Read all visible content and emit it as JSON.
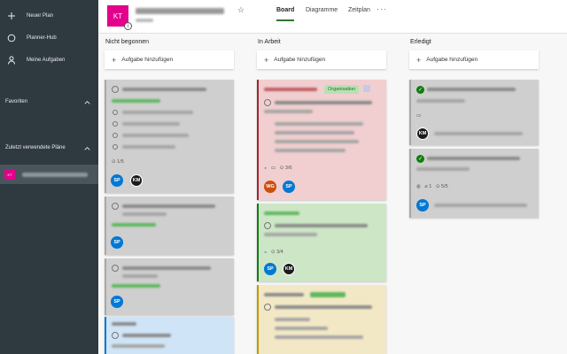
{
  "sidebar": {
    "items": [
      {
        "label": "Neuer Plan",
        "icon": "plus-icon"
      },
      {
        "label": "Planner-Hub",
        "icon": "hub-icon"
      },
      {
        "label": "Meine Aufgaben",
        "icon": "person-icon"
      }
    ],
    "favorites_label": "Favoriten",
    "recent_label": "Zuletzt verwendete Pläne",
    "recent_plan_initials": "KT"
  },
  "header": {
    "plan_initials": "KT",
    "info_glyph": "i",
    "star_glyph": "☆",
    "tabs": [
      {
        "label": "Board",
        "active": true
      },
      {
        "label": "Diagramme",
        "active": false
      },
      {
        "label": "Zeitplan",
        "active": false
      }
    ],
    "more_glyph": "···"
  },
  "board": {
    "add_task_label": "Aufgabe hinzufügen",
    "columns": [
      {
        "title": "Nicht begonnen",
        "cards": [
          {
            "checklist": "1/5",
            "avatars": [
              "SP",
              "KM"
            ]
          },
          {
            "avatars": [
              "SP"
            ]
          },
          {
            "avatars": [
              "SP"
            ]
          },
          {
            "avatars": []
          }
        ]
      },
      {
        "title": "In Arbeit",
        "cards": [
          {
            "label": "Organisation",
            "checklist": "3/6",
            "avatars": [
              "WG",
              "SP"
            ]
          },
          {
            "checklist": "3/4",
            "avatars": [
              "SP",
              "KM"
            ]
          },
          {
            "avatars": []
          }
        ]
      },
      {
        "title": "Erledigt",
        "cards": [
          {
            "avatars": [
              "KM"
            ]
          },
          {
            "attachments": "1",
            "checklist": "5/5",
            "avatars": [
              "SP"
            ]
          }
        ]
      }
    ]
  },
  "colors": {
    "sidebar_bg": "#2f3a40",
    "brand_tile": "#e3008c",
    "accent_green": "#107c10",
    "avatar_blue": "#0078d4",
    "avatar_orange": "#ca5010"
  }
}
